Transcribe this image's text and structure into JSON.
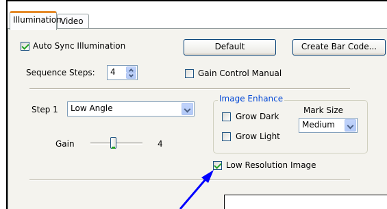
{
  "tabs": [
    {
      "label": "Illumination",
      "active": true
    },
    {
      "label": "Video",
      "active": false
    }
  ],
  "auto_sync": {
    "label": "Auto Sync Illumination",
    "checked": true
  },
  "buttons": {
    "default": "Default",
    "create_bar_code": "Create Bar Code..."
  },
  "sequence_steps": {
    "label": "Sequence Steps:",
    "value": "4"
  },
  "gain_control_manual": {
    "label": "Gain Control Manual",
    "checked": false
  },
  "step": {
    "label": "Step 1",
    "selected": "Low Angle"
  },
  "gain": {
    "label": "Gain",
    "value": "4",
    "level_fraction": 0.45
  },
  "image_enhance": {
    "title": "Image Enhance",
    "grow_dark": {
      "label": "Grow Dark",
      "checked": false
    },
    "grow_light": {
      "label": "Grow Light",
      "checked": false
    },
    "mark_size": {
      "label": "Mark Size",
      "selected": "Medium"
    }
  },
  "low_resolution": {
    "label": "Low Resolution Image",
    "checked": true
  },
  "colors": {
    "arrow": "#0000ff",
    "accent_tab": "#e68b2c",
    "group_title": "#0046d5"
  }
}
